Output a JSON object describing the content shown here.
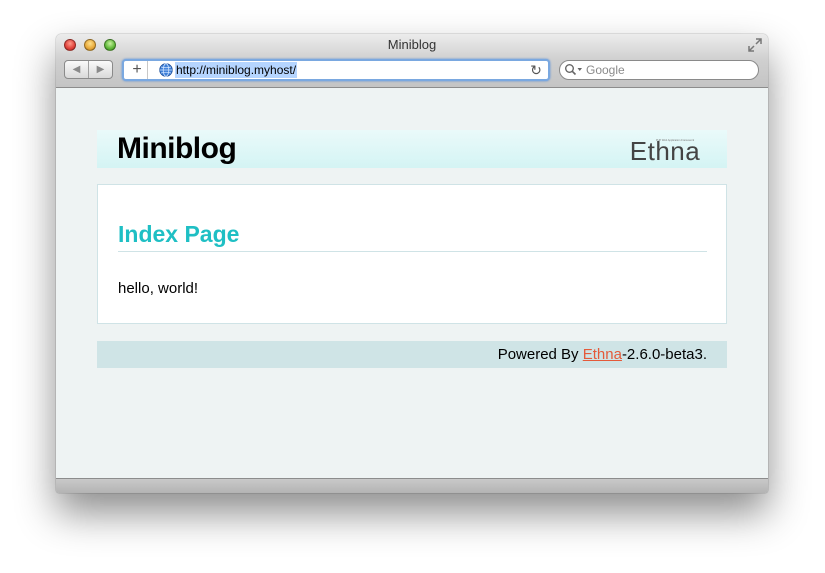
{
  "window": {
    "title": "Miniblog"
  },
  "toolbar": {
    "back_glyph": "◀",
    "forward_glyph": "▶",
    "add_glyph": "+",
    "url": "http://miniblog.myhost/",
    "reload_glyph": "↻",
    "search_placeholder": "Google"
  },
  "page": {
    "site_title": "Miniblog",
    "logo_text": "Ethna",
    "logo_tagline": "PHP Web Application Framework",
    "heading": "Index Page",
    "body": "hello, world!",
    "footer": {
      "prefix": "Powered By ",
      "link_label": "Ethna",
      "suffix": "-2.6.0-beta3."
    }
  },
  "colors": {
    "heading": "#1fbfc4",
    "footer_link": "#e45a3a",
    "header_bg": "#d4f4f4",
    "footer_bg": "#cfe4e6",
    "page_bg": "#eef3f3"
  },
  "icons": {
    "window_controls": [
      "close-icon",
      "minimize-icon",
      "zoom-icon"
    ],
    "resize": "fullscreen-icon",
    "url_favicon": "globe-icon",
    "reload": "reload-icon",
    "search": "search-icon"
  }
}
